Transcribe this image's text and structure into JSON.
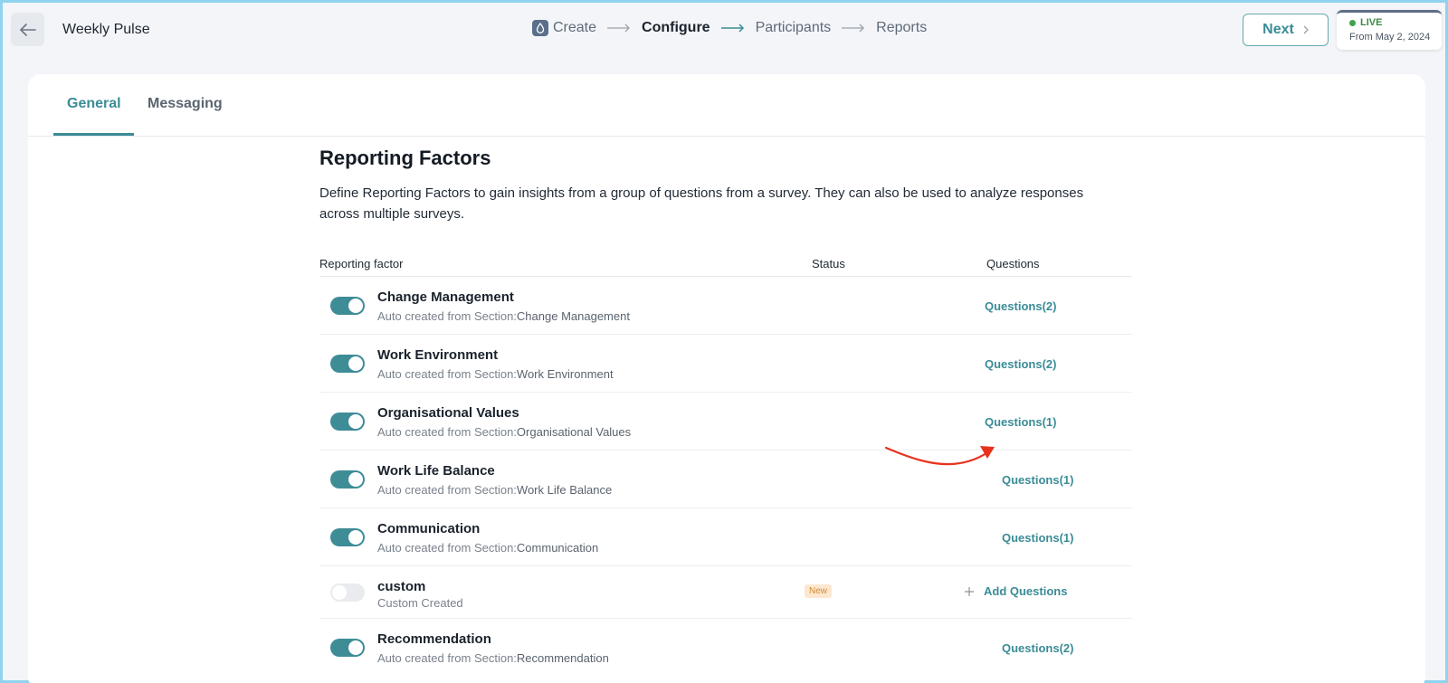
{
  "header": {
    "title": "Weekly Pulse",
    "steps": [
      {
        "label": "Create"
      },
      {
        "label": "Configure"
      },
      {
        "label": "Participants"
      },
      {
        "label": "Reports"
      }
    ],
    "next_label": "Next",
    "status": {
      "label": "LIVE",
      "date": "From May 2, 2024"
    }
  },
  "tabs": [
    {
      "label": "General"
    },
    {
      "label": "Messaging"
    }
  ],
  "section": {
    "title": "Reporting Factors",
    "description": "Define Reporting Factors to gain insights from a group of questions from a survey. They can also be used to analyze responses across multiple surveys."
  },
  "table": {
    "columns": {
      "factor": "Reporting factor",
      "status": "Status",
      "questions": "Questions"
    },
    "subtitle_prefix": "Auto created from Section:",
    "rows": [
      {
        "name": "Change Management",
        "source": "Change Management",
        "enabled": true,
        "questions": "Questions(2)"
      },
      {
        "name": "Work Environment",
        "source": "Work Environment",
        "enabled": true,
        "questions": "Questions(2)"
      },
      {
        "name": "Organisational Values",
        "source": "Organisational Values",
        "enabled": true,
        "questions": "Questions(1)"
      },
      {
        "name": "Work Life Balance",
        "source": "Work Life Balance",
        "enabled": true,
        "questions": "Questions(1)"
      },
      {
        "name": "Communication",
        "source": "Communication",
        "enabled": true,
        "questions": "Questions(1)"
      },
      {
        "name": "custom",
        "subtitle": "Custom Created",
        "enabled": false,
        "badge": "New",
        "add_label": "Add Questions"
      },
      {
        "name": "Recommendation",
        "source": "Recommendation",
        "enabled": true,
        "questions": "Questions(2)"
      }
    ]
  },
  "colors": {
    "accent": "#3a8c96",
    "annotation": "#e8321e"
  }
}
